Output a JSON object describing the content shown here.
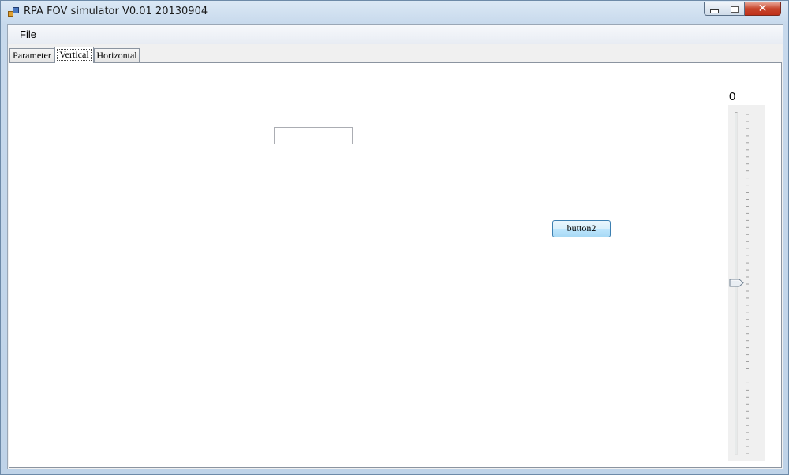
{
  "window": {
    "title": "RPA FOV simulator V0.01 20130904",
    "caption_buttons": [
      "minimize",
      "maximize",
      "close"
    ],
    "close_glyph": "✕"
  },
  "menu": {
    "items": [
      {
        "label": "File"
      }
    ]
  },
  "tabs": [
    {
      "label": "Parameter",
      "selected": false
    },
    {
      "label": "Vertical",
      "selected": true
    },
    {
      "label": "Horizontal",
      "selected": false
    }
  ],
  "vertical_page": {
    "textbox": {
      "value": ""
    },
    "button2": {
      "label": "button2"
    },
    "slider": {
      "value_label": "0",
      "value": 0,
      "orientation": "vertical",
      "position_fraction": 0.5
    }
  },
  "colors": {
    "button_border": "#3c7fb1",
    "close_button": "#c7452c"
  }
}
